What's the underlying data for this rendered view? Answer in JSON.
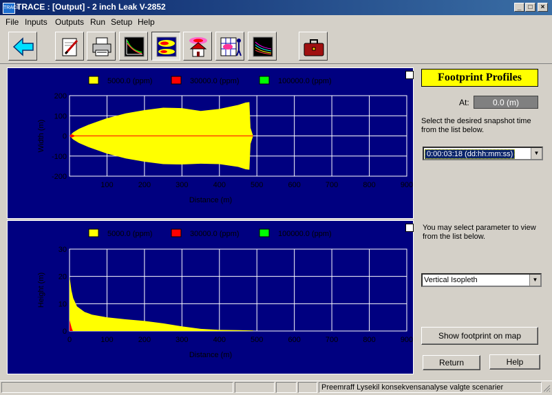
{
  "window": {
    "title": "TRACE : [Output] - 2 inch Leak V-2852",
    "icon_label": "TRACE",
    "min_glyph": "_",
    "max_glyph": "□",
    "close_glyph": "×"
  },
  "menu": [
    "File",
    "Inputs",
    "Outputs",
    "Run",
    "Setup",
    "Help"
  ],
  "toolbar": {
    "buttons": [
      {
        "name": "back-arrow-icon"
      },
      {
        "name": "edit-pencil-icon"
      },
      {
        "name": "printer-icon"
      },
      {
        "name": "line-plot-icon"
      },
      {
        "name": "footprint-plot-icon",
        "pressed": true
      },
      {
        "name": "house-plume-icon"
      },
      {
        "name": "grid-person-icon"
      },
      {
        "name": "multi-curve-plot-icon"
      },
      {
        "name": "briefcase-icon"
      }
    ]
  },
  "legend": [
    {
      "label": "5000.0 (ppm)",
      "color": "#ffff00"
    },
    {
      "label": "30000.0 (ppm)",
      "color": "#ff0000"
    },
    {
      "label": "100000.0 (ppm)",
      "color": "#00ff00"
    }
  ],
  "colors": {
    "plot_bg": "#000080",
    "grid": "#ffffff",
    "axis_text": "#000000"
  },
  "chart_data": [
    {
      "type": "area",
      "title": "",
      "xlabel": "Distance (m)",
      "ylabel": "Width (m)",
      "xlim": [
        0,
        900
      ],
      "ylim": [
        -200,
        200
      ],
      "xticks": [
        100,
        200,
        300,
        400,
        500,
        600,
        700,
        800,
        900
      ],
      "yticks": [
        -200,
        -100,
        0,
        100,
        200
      ],
      "series": [
        {
          "name": "5000.0 (ppm)",
          "color": "#ffff00",
          "x": [
            0,
            10,
            25,
            50,
            100,
            150,
            200,
            250,
            300,
            350,
            400,
            450,
            470,
            480,
            483,
            490
          ],
          "y_upper": [
            0,
            18,
            35,
            55,
            88,
            112,
            128,
            140,
            138,
            124,
            134,
            154,
            166,
            168,
            40,
            0
          ],
          "y_lower": [
            0,
            -18,
            -35,
            -55,
            -88,
            -112,
            -128,
            -140,
            -142,
            -138,
            -140,
            -154,
            -166,
            -168,
            -40,
            0
          ]
        },
        {
          "name": "30000.0 (ppm)",
          "color": "#ff0000",
          "x": [
            0,
            5,
            10,
            15
          ],
          "y_upper": [
            0,
            8,
            5,
            0
          ],
          "y_lower": [
            0,
            -8,
            -5,
            0
          ]
        }
      ],
      "centerline_end_x": 490
    },
    {
      "type": "area",
      "title": "",
      "xlabel": "Distance (m)",
      "ylabel": "Height (m)",
      "xlim": [
        0,
        900
      ],
      "ylim": [
        0,
        30
      ],
      "xticks": [
        0,
        100,
        200,
        300,
        400,
        500,
        600,
        700,
        800,
        900
      ],
      "yticks": [
        0,
        10,
        20,
        30
      ],
      "series": [
        {
          "name": "5000.0 (ppm)",
          "color": "#ffff00",
          "x": [
            0,
            5,
            10,
            20,
            40,
            60,
            100,
            150,
            200,
            250,
            300,
            350,
            400,
            450,
            490,
            490
          ],
          "y": [
            20,
            15,
            12,
            9,
            7,
            6,
            5,
            4.3,
            3.7,
            2.8,
            1.7,
            0.8,
            0.4,
            0.3,
            0.2,
            0
          ]
        },
        {
          "name": "30000.0 (ppm)",
          "color": "#ff0000",
          "x": [
            0,
            3,
            6,
            9
          ],
          "y": [
            4,
            2.5,
            1,
            0
          ]
        }
      ]
    }
  ],
  "panel": {
    "title": "Footprint Profiles",
    "at_label": "At:",
    "at_value": "0.0 (m)",
    "snapshot_help": "Select the desired snapshot time from the list below.",
    "snapshot_value": "0:00:03:18 (dd:hh:mm:ss)",
    "param_help": "You may select parameter to view from the list below.",
    "param_value": "Vertical Isopleth",
    "show_map_label": "Show footprint on map",
    "return_label": "Return",
    "help_label": "Help"
  },
  "status": {
    "text": "Preemraff Lysekil konsekvensanalyse valgte scenarier"
  }
}
